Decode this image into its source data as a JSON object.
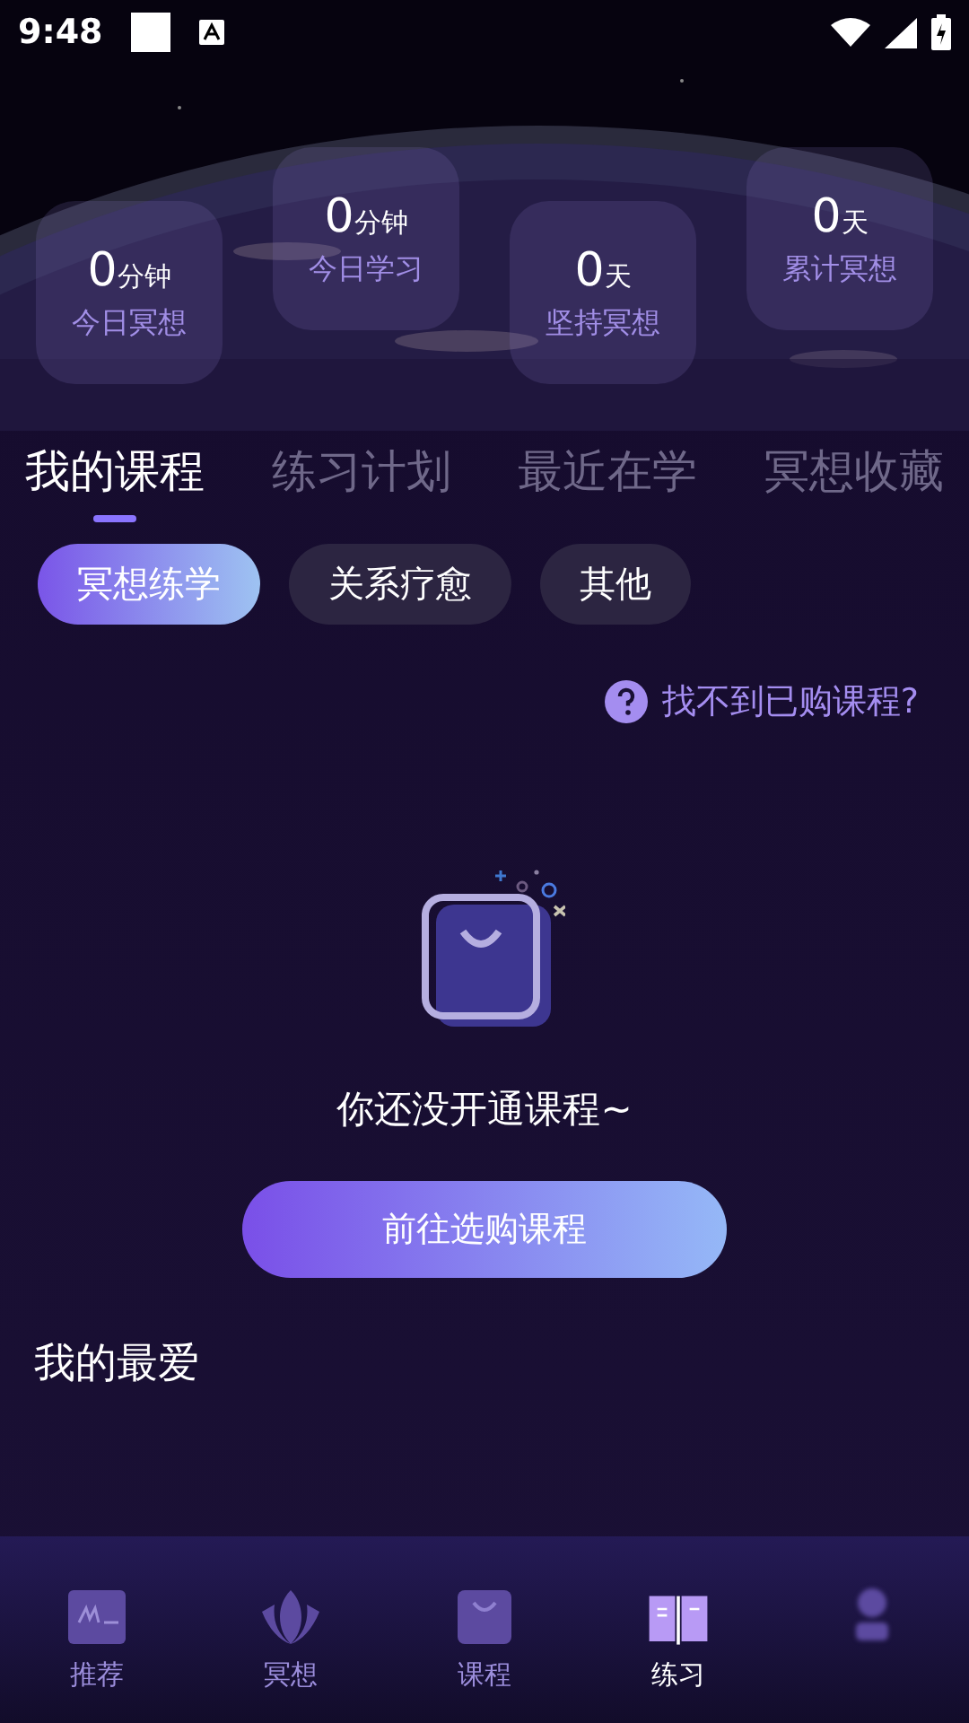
{
  "status_bar": {
    "time": "9:48"
  },
  "stats": [
    {
      "value": "0",
      "unit": "分钟",
      "label": "今日冥想"
    },
    {
      "value": "0",
      "unit": "分钟",
      "label": "今日学习"
    },
    {
      "value": "0",
      "unit": "天",
      "label": "坚持冥想"
    },
    {
      "value": "0",
      "unit": "天",
      "label": "累计冥想"
    }
  ],
  "tabs": [
    {
      "label": "我的课程",
      "selected": true
    },
    {
      "label": "练习计划",
      "selected": false
    },
    {
      "label": "最近在学",
      "selected": false
    },
    {
      "label": "冥想收藏",
      "selected": false
    }
  ],
  "chips": [
    {
      "label": "冥想练学",
      "selected": true
    },
    {
      "label": "关系疗愈",
      "selected": false
    },
    {
      "label": "其他",
      "selected": false
    }
  ],
  "help_link": "找不到已购课程?",
  "empty_state": {
    "message": "你还没开通课程~",
    "button": "前往选购课程"
  },
  "favorites_title": "我的最爱",
  "nav": [
    {
      "kind": "more",
      "label": "推荐",
      "selected": false
    },
    {
      "kind": "lotus",
      "label": "冥想",
      "selected": false
    },
    {
      "kind": "bag",
      "label": "课程",
      "selected": false
    },
    {
      "kind": "book",
      "label": "练习",
      "selected": true
    },
    {
      "kind": "person",
      "selected": false
    }
  ]
}
